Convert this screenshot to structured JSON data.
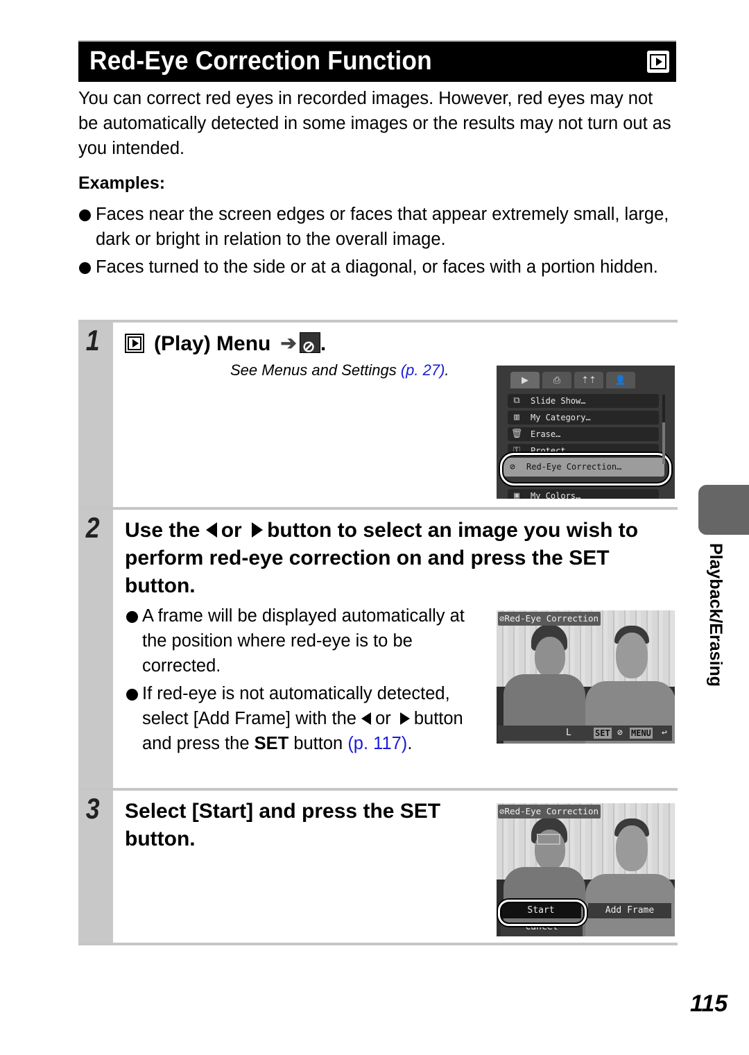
{
  "header": {
    "title": "Red-Eye Correction Function",
    "mode_icon": "play-icon"
  },
  "intro": {
    "text": "You can correct red eyes in recorded images. However, red eyes may not be automatically detected in some images or the results may not turn out as you intended."
  },
  "examples": {
    "heading": "Examples:",
    "items": [
      "Faces near the screen edges or faces that appear extremely small, large, dark or bright in relation to the overall image.",
      "Faces turned to the side or at a diagonal, or faces with a portion hidden."
    ]
  },
  "steps": [
    {
      "number": "1",
      "title": "(Play) Menu",
      "period": ".",
      "note_prefix": "See Menus and Settings ",
      "note_link": "(p. 27)",
      "note_suffix": ".",
      "screen": {
        "tabs": [
          "▶",
          "⎙",
          "⇡⇡",
          "👤"
        ],
        "menu_items": [
          {
            "icon": "slideshow-icon",
            "glyph": "⧉",
            "label": "Slide Show…"
          },
          {
            "icon": "category-icon",
            "glyph": "▥",
            "label": "My Category…"
          },
          {
            "icon": "erase-icon",
            "glyph": "🗑",
            "label": "Erase…"
          },
          {
            "icon": "protect-icon",
            "glyph": "⚿",
            "label": "Protect…"
          },
          {
            "icon": "red-eye-icon",
            "glyph": "⊘",
            "label": "Red-Eye Correction…"
          },
          {
            "icon": "my-colors-icon",
            "glyph": "▣",
            "label": "My Colors…"
          }
        ],
        "highlighted_index": 4
      }
    },
    {
      "number": "2",
      "title_part1": "Use the",
      "title_or": "or",
      "title_part2": "button to select an image you wish to perform red-eye correction on and press the",
      "title_set": "SET",
      "title_end": "button.",
      "bullets": [
        {
          "text": "A frame will be displayed automatically at the position where red-eye is to be corrected."
        },
        {
          "text_prefix": "If red-eye is not automatically detected, select [Add Frame] with the",
          "text_or": "or",
          "text_mid": "button and press the",
          "text_set": "SET",
          "text_button": "button",
          "link": "(p. 117)",
          "text_end": "."
        }
      ],
      "screen": {
        "label": "Red-Eye Correction",
        "bar_size": "L",
        "bar_set": "SET",
        "bar_menu": "MENU",
        "bar_back": "↩"
      }
    },
    {
      "number": "3",
      "title": "Select [Start] and press the SET button.",
      "screen": {
        "label": "Red-Eye Correction",
        "start": "Start",
        "add_frame": "Add Frame",
        "cancel": "Cancel"
      }
    }
  ],
  "side_tab": {
    "label": "Playback/Erasing"
  },
  "page_number": "115"
}
